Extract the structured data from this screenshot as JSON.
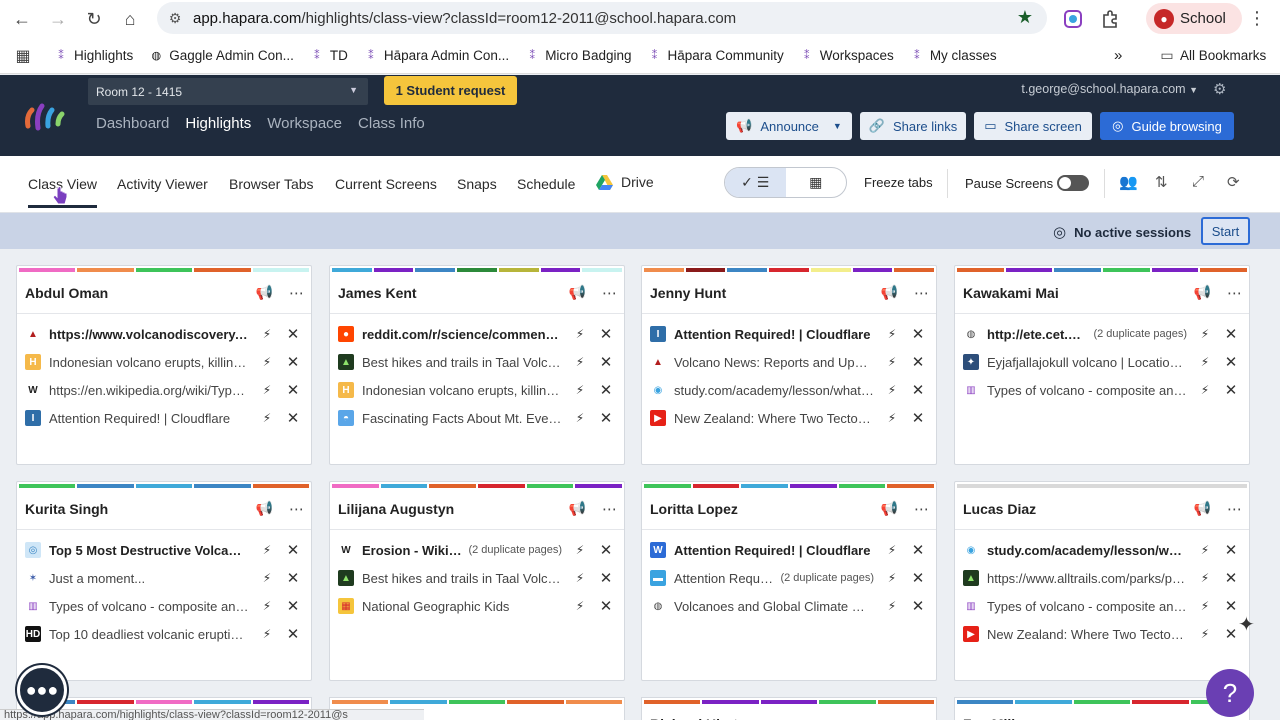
{
  "browser": {
    "url_domain": "app.hapara.com",
    "url_path": "/highlights/class-view?classId=room12-2011@school.hapara.com",
    "profile_label": "School",
    "bookmarks": [
      {
        "label": "Highlights"
      },
      {
        "label": "Gaggle Admin Con..."
      },
      {
        "label": "TD"
      },
      {
        "label": "Hāpara Admin Con..."
      },
      {
        "label": "Micro Badging"
      },
      {
        "label": "Hāpara Community"
      },
      {
        "label": "Workspaces"
      },
      {
        "label": "My classes"
      }
    ],
    "all_bookmarks": "All Bookmarks",
    "status_url": "https://app.hapara.com/highlights/class-view?classId=room12-2011@s"
  },
  "header": {
    "room": "Room 12 - 1415",
    "request_button": "1 Student request",
    "nav": [
      "Dashboard",
      "Highlights",
      "Workspace",
      "Class Info"
    ],
    "user": "t.george@school.hapara.com",
    "buttons": {
      "announce": "Announce",
      "share_links": "Share links",
      "share_screen": "Share screen",
      "guide_browsing": "Guide browsing"
    }
  },
  "subnav": {
    "tabs": [
      "Class View",
      "Activity Viewer",
      "Browser Tabs",
      "Current Screens",
      "Snaps",
      "Schedule",
      "Drive"
    ],
    "freeze_tabs": "Freeze tabs",
    "pause_screens": "Pause Screens"
  },
  "session": {
    "status": "No active sessions",
    "start": "Start"
  },
  "colors": {
    "header_bg": "#1f2b3d",
    "accent": "#2c6bd6",
    "request": "#f5c53c"
  },
  "students": [
    {
      "name": "Abdul Oman",
      "bars": [
        "#f06bc4",
        "#f08c4c",
        "#3ec45a",
        "#e0622a",
        "#c8f3f0"
      ],
      "tabs": [
        {
          "title": "https://www.volcanodiscovery.com",
          "bold": true,
          "icon": "volcano-icon",
          "fav_bg": "#ffffff",
          "fav_color": "#b21e1e",
          "glyph": "▲",
          "dup": ""
        },
        {
          "title": "Indonesian volcano erupts, killing at least",
          "bold": false,
          "icon": "hinge-icon",
          "fav_bg": "#f5b94a",
          "fav_color": "#fff",
          "glyph": "H",
          "dup": ""
        },
        {
          "title": "https://en.wikipedia.org/wiki/Types_of_volcanoes",
          "bold": false,
          "icon": "wikipedia-icon",
          "fav_bg": "#ffffff",
          "fav_color": "#222",
          "glyph": "W",
          "dup": ""
        },
        {
          "title": "Attention Required! | Cloudflare",
          "bold": false,
          "icon": "cloudflare-icon",
          "fav_bg": "#2f6ea8",
          "fav_color": "#fff",
          "glyph": "I",
          "dup": ""
        }
      ]
    },
    {
      "name": "James Kent",
      "bars": [
        "#3fa9d9",
        "#7b22c4",
        "#3c86c4",
        "#2c8a3a",
        "#b7b53a",
        "#7b22c4",
        "#c8f3f0"
      ],
      "tabs": [
        {
          "title": "reddit.com/r/science/comments/volcano",
          "bold": true,
          "icon": "reddit-icon",
          "fav_bg": "#ff4500",
          "fav_color": "#fff",
          "glyph": "●",
          "dup": ""
        },
        {
          "title": "Best hikes and trails in Taal Volcano",
          "bold": false,
          "icon": "alltrails-icon",
          "fav_bg": "#1f3b1f",
          "fav_color": "#8ee36b",
          "glyph": "▲",
          "dup": ""
        },
        {
          "title": "Indonesian volcano erupts, killing at least",
          "bold": false,
          "icon": "hinge-icon",
          "fav_bg": "#f5b94a",
          "fav_color": "#fff",
          "glyph": "H",
          "dup": ""
        },
        {
          "title": "Fascinating Facts About Mt. Everest",
          "bold": false,
          "icon": "sunset-icon",
          "fav_bg": "#5aa6e8",
          "fav_color": "#fff",
          "glyph": "◓",
          "dup": ""
        }
      ]
    },
    {
      "name": "Jenny Hunt",
      "bars": [
        "#f08c4c",
        "#8a1a1a",
        "#3c86c4",
        "#d7262e",
        "#f3ee8c",
        "#7b22c4",
        "#e0622a"
      ],
      "tabs": [
        {
          "title": "Attention Required! | Cloudflare",
          "bold": true,
          "icon": "cloudflare-icon",
          "fav_bg": "#2f6ea8",
          "fav_color": "#fff",
          "glyph": "I",
          "dup": ""
        },
        {
          "title": "Volcano News: Reports and Updates",
          "bold": false,
          "icon": "volcano-icon",
          "fav_bg": "#ffffff",
          "fav_color": "#b21e1e",
          "glyph": "▲",
          "dup": ""
        },
        {
          "title": "study.com/academy/lesson/what-is-a-volcano",
          "bold": false,
          "icon": "study-icon",
          "fav_bg": "#ffffff",
          "fav_color": "#3aa3e0",
          "glyph": "◉",
          "dup": ""
        },
        {
          "title": "New Zealand: Where Two Tectonic Plates",
          "bold": false,
          "icon": "youtube-icon",
          "fav_bg": "#e62117",
          "fav_color": "#fff",
          "glyph": "▶",
          "dup": ""
        }
      ]
    },
    {
      "name": "Kawakami Mai",
      "bars": [
        "#e0622a",
        "#7b22c4",
        "#3c86c4",
        "#3ec45a",
        "#7b22c4",
        "#e0622a"
      ],
      "tabs": [
        {
          "title": "http://ete.cet.edu",
          "bold": true,
          "icon": "globe-icon",
          "fav_bg": "#ffffff",
          "fav_color": "#444",
          "glyph": "◍",
          "dup": "(2 duplicate pages)"
        },
        {
          "title": "Eyjafjallajokull volcano | Location, Eruption",
          "bold": false,
          "icon": "britannica-icon",
          "fav_bg": "#2d4e7a",
          "fav_color": "#fff",
          "glyph": "✦",
          "dup": ""
        },
        {
          "title": "Types of volcano - composite and shield",
          "bold": false,
          "icon": "library-icon",
          "fav_bg": "#ffffff",
          "fav_color": "#8a3fc0",
          "glyph": "▥",
          "dup": ""
        }
      ]
    },
    {
      "name": "Kurita Singh",
      "bars": [
        "#3ec45a",
        "#3c86c4",
        "#3fa9d9",
        "#3c86c4",
        "#e0622a"
      ],
      "tabs": [
        {
          "title": "Top 5 Most Destructive Volcanic Eruptions",
          "bold": true,
          "icon": "target-icon",
          "fav_bg": "#cfe6f7",
          "fav_color": "#3a86c4",
          "glyph": "◎",
          "dup": ""
        },
        {
          "title": "Just a moment...",
          "bold": false,
          "icon": "bird-icon",
          "fav_bg": "#ffffff",
          "fav_color": "#3b5ba8",
          "glyph": "✶",
          "dup": ""
        },
        {
          "title": "Types of volcano - composite and shield",
          "bold": false,
          "icon": "library-icon",
          "fav_bg": "#ffffff",
          "fav_color": "#8a3fc0",
          "glyph": "▥",
          "dup": ""
        },
        {
          "title": "Top 10 deadliest volcanic eruptions",
          "bold": false,
          "icon": "hd-icon",
          "fav_bg": "#111111",
          "fav_color": "#fff",
          "glyph": "HD",
          "dup": ""
        }
      ]
    },
    {
      "name": "Lilijana Augustyn",
      "bars": [
        "#f06bc4",
        "#3fa9d9",
        "#e0622a",
        "#d7262e",
        "#3ec45a",
        "#7b22c4"
      ],
      "tabs": [
        {
          "title": "Erosion - Wikipedia",
          "bold": true,
          "icon": "wikipedia-icon",
          "fav_bg": "#ffffff",
          "fav_color": "#222",
          "glyph": "W",
          "dup": "(2 duplicate pages)"
        },
        {
          "title": "Best hikes and trails in Taal Volcano",
          "bold": false,
          "icon": "alltrails-icon",
          "fav_bg": "#1f3b1f",
          "fav_color": "#8ee36b",
          "glyph": "▲",
          "dup": ""
        },
        {
          "title": "National Geographic Kids",
          "bold": false,
          "icon": "natgeo-icon",
          "fav_bg": "#f5c53c",
          "fav_color": "#d7262e",
          "glyph": "▦",
          "dup": ""
        }
      ]
    },
    {
      "name": "Loritta Lopez",
      "bars": [
        "#3ec45a",
        "#d7262e",
        "#3fa9d9",
        "#7b22c4",
        "#3ec45a",
        "#e0622a"
      ],
      "tabs": [
        {
          "title": "Attention Required! | Cloudflare",
          "bold": true,
          "icon": "wordpress-icon",
          "fav_bg": "#2c6bd6",
          "fav_color": "#fff",
          "glyph": "W",
          "dup": ""
        },
        {
          "title": "Attention Required",
          "bold": false,
          "icon": "chat-icon",
          "fav_bg": "#3aa3e0",
          "fav_color": "#fff",
          "glyph": "▬",
          "dup": "(2 duplicate pages)"
        },
        {
          "title": "Volcanoes and Global Climate Change",
          "bold": false,
          "icon": "globe-icon",
          "fav_bg": "#ffffff",
          "fav_color": "#444",
          "glyph": "◍",
          "dup": ""
        }
      ]
    },
    {
      "name": "Lucas Diaz",
      "bars": [
        "#d9d9d9"
      ],
      "tabs": [
        {
          "title": "study.com/academy/lesson/what-is",
          "bold": true,
          "icon": "study-icon",
          "fav_bg": "#ffffff",
          "fav_color": "#3aa3e0",
          "glyph": "◉",
          "dup": ""
        },
        {
          "title": "https://www.alltrails.com/parks/philippines",
          "bold": false,
          "icon": "alltrails-icon",
          "fav_bg": "#1f3b1f",
          "fav_color": "#8ee36b",
          "glyph": "▲",
          "dup": ""
        },
        {
          "title": "Types of volcano - composite and shield",
          "bold": false,
          "icon": "library-icon",
          "fav_bg": "#ffffff",
          "fav_color": "#8a3fc0",
          "glyph": "▥",
          "dup": ""
        },
        {
          "title": "New Zealand: Where Two Tectonic Plates",
          "bold": false,
          "icon": "youtube-icon",
          "fav_bg": "#e62117",
          "fav_color": "#fff",
          "glyph": "▶",
          "dup": ""
        }
      ]
    }
  ],
  "partial_students": [
    {
      "name": "",
      "bars": [
        "#3c86c4",
        "#d7262e",
        "#f06bc4",
        "#3fa9d9",
        "#7b22c4"
      ]
    },
    {
      "name": "",
      "bars": [
        "#f08c4c",
        "#3fa9d9",
        "#3ec45a",
        "#e0622a",
        "#f08c4c"
      ]
    },
    {
      "name": "Richard Hirata",
      "bars": [
        "#e0622a",
        "#7b22c4",
        "#7b22c4",
        "#3ec45a",
        "#e0622a"
      ]
    },
    {
      "name": "Zoe Miller",
      "bars": [
        "#3c86c4",
        "#3fa9d9",
        "#3ec45a",
        "#d7262e",
        "#3ec45a"
      ]
    }
  ]
}
